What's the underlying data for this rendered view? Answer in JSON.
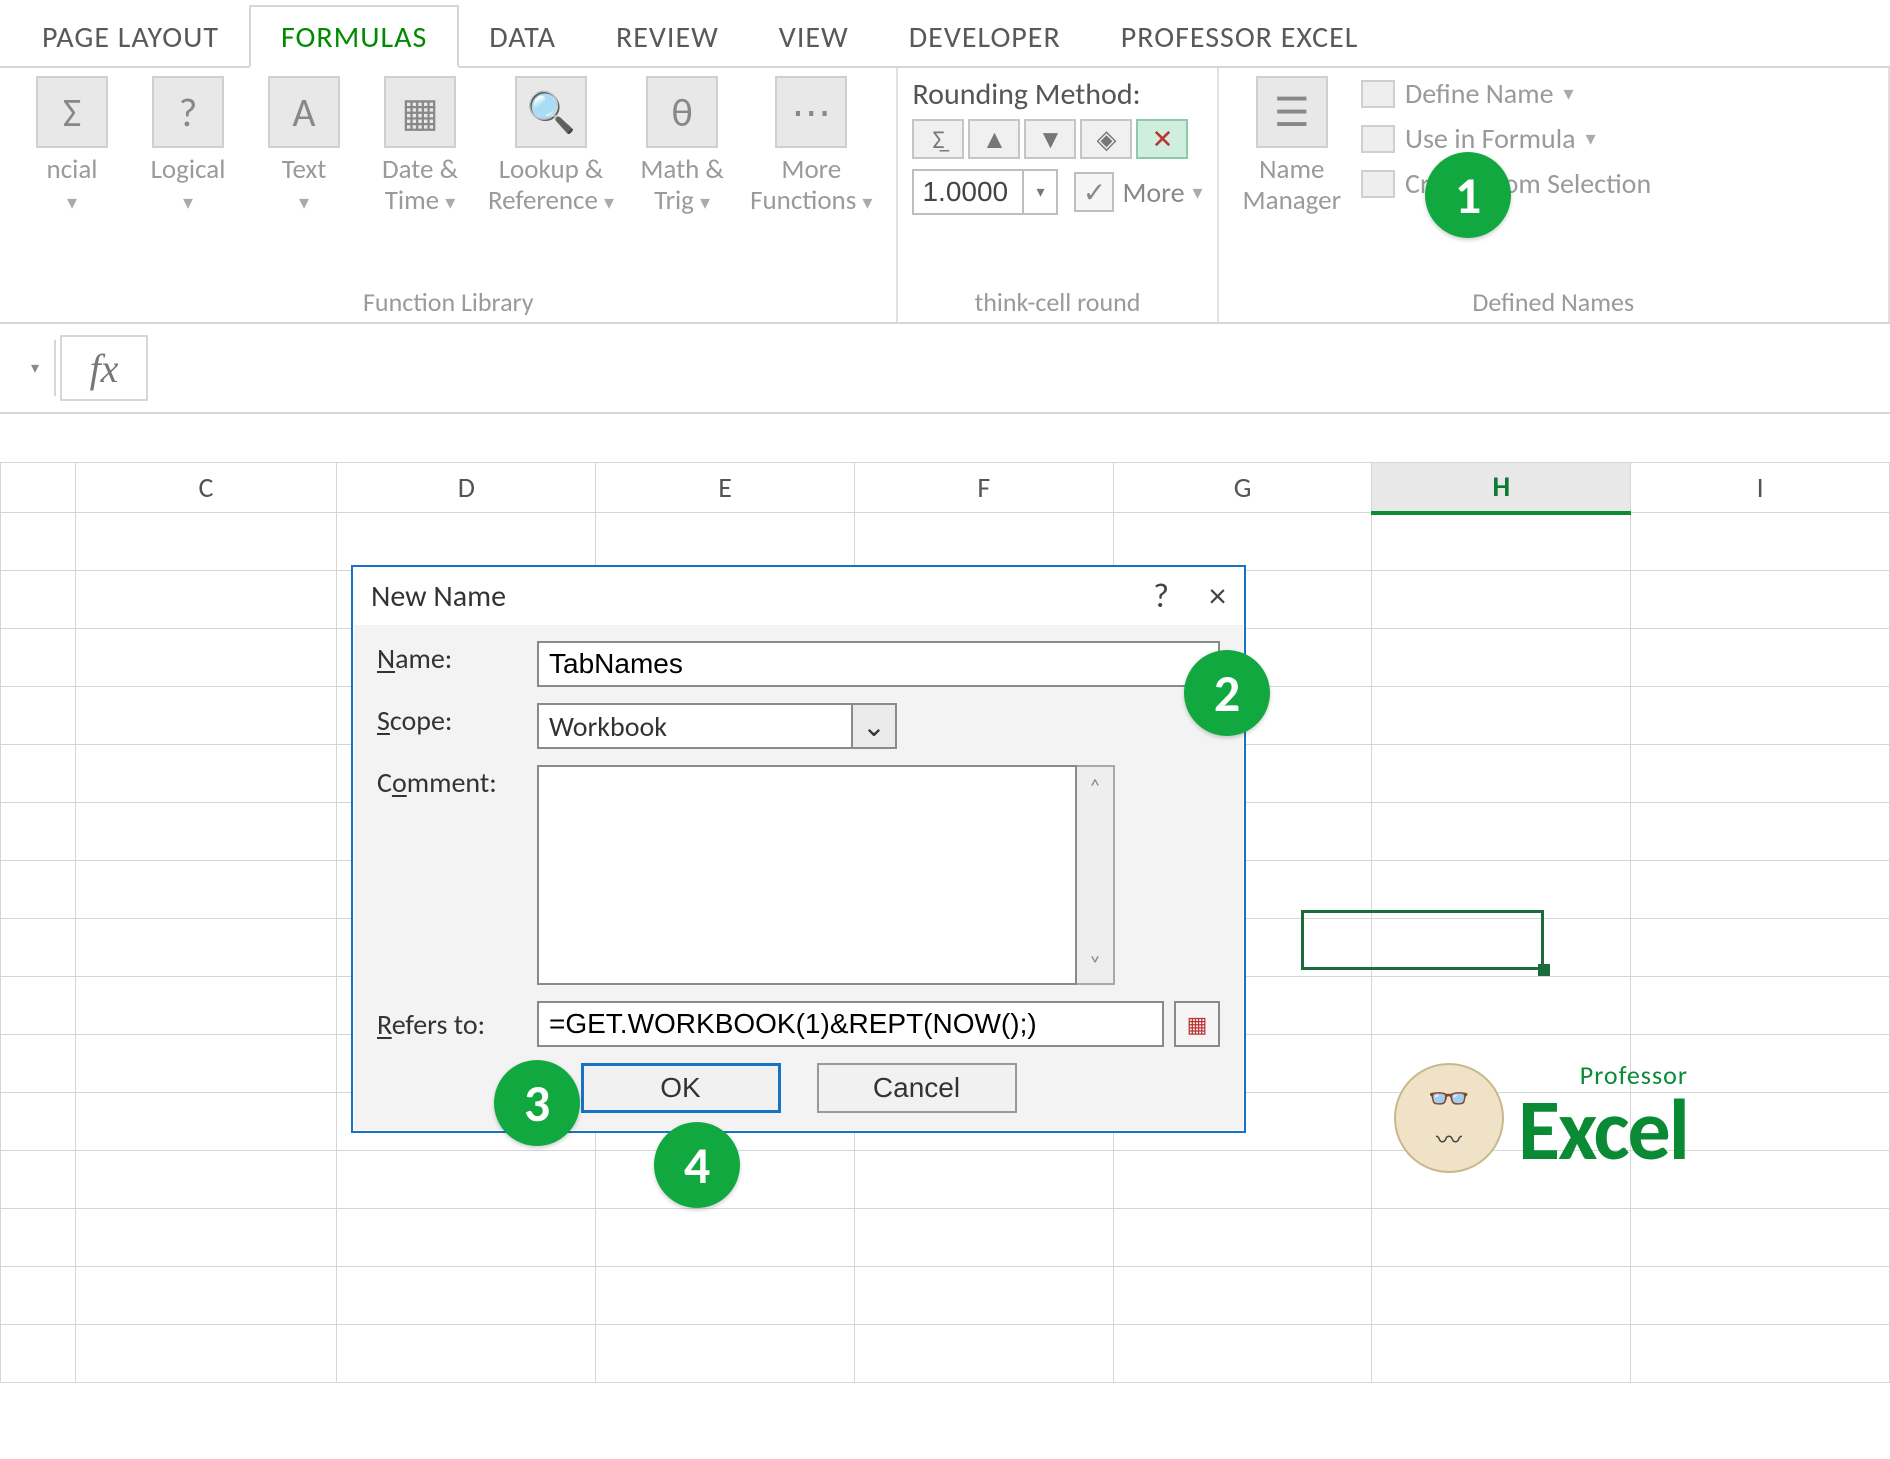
{
  "ribbon": {
    "tabs": [
      "PAGE LAYOUT",
      "FORMULAS",
      "DATA",
      "REVIEW",
      "VIEW",
      "DEVELOPER",
      "PROFESSOR EXCEL"
    ],
    "active_tab_index": 1,
    "groups": {
      "function_library": {
        "label": "Function Library",
        "buttons": [
          {
            "label_line1": "ncial",
            "label_line2": "",
            "icon": "∑"
          },
          {
            "label_line1": "Logical",
            "label_line2": "",
            "icon": "?"
          },
          {
            "label_line1": "Text",
            "label_line2": "",
            "icon": "A"
          },
          {
            "label_line1": "Date &",
            "label_line2": "Time",
            "icon": "📅"
          },
          {
            "label_line1": "Lookup &",
            "label_line2": "Reference",
            "icon": "🔍"
          },
          {
            "label_line1": "Math &",
            "label_line2": "Trig",
            "icon": "θ"
          },
          {
            "label_line1": "More",
            "label_line2": "Functions",
            "icon": "⋯"
          }
        ]
      },
      "thinkcell": {
        "title": "Rounding Method:",
        "label": "think-cell round",
        "value": "1.0000",
        "more_label": "More"
      },
      "defined_names": {
        "label": "Defined Names",
        "name_manager_line1": "Name",
        "name_manager_line2": "Manager",
        "items": [
          "Define Name",
          "Use in Formula",
          "Create from Selection"
        ]
      }
    }
  },
  "formula_bar": {
    "fx_label": "fx",
    "value": ""
  },
  "sheet": {
    "columns": [
      "",
      "C",
      "D",
      "E",
      "F",
      "G",
      "H",
      "I"
    ],
    "selected_column_index": 6,
    "rows_visible": 15,
    "selected_cell": {
      "col": 6,
      "row": 4
    }
  },
  "dialog": {
    "title": "New Name",
    "labels": {
      "name": "Name:",
      "scope": "Scope:",
      "comment": "Comment:",
      "refers": "Refers to:"
    },
    "name_value": "TabNames",
    "scope_value": "Workbook",
    "comment_value": "",
    "refers_value": "=GET.WORKBOOK(1)&REPT(NOW();)",
    "buttons": {
      "ok": "OK",
      "cancel": "Cancel"
    },
    "help_char": "?",
    "close_char": "×"
  },
  "badges": [
    "1",
    "2",
    "3",
    "4"
  ],
  "logo": {
    "top": "Professor",
    "bottom": "Excel"
  }
}
